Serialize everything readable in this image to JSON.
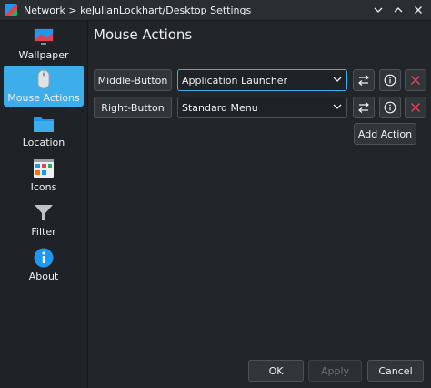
{
  "window": {
    "title": "Network > keJulianLockhart/Desktop Settings",
    "buttons": [
      "minimize",
      "maximize",
      "close"
    ]
  },
  "sidebar": {
    "items": [
      {
        "label": "Wallpaper",
        "icon": "wallpaper-icon",
        "active": false
      },
      {
        "label": "Mouse Actions",
        "icon": "mouse-icon",
        "active": true
      },
      {
        "label": "Location",
        "icon": "folder-icon",
        "active": false
      },
      {
        "label": "Icons",
        "icon": "icons-view-icon",
        "active": false
      },
      {
        "label": "Filter",
        "icon": "filter-icon",
        "active": false
      },
      {
        "label": "About",
        "icon": "info-icon",
        "active": false
      }
    ]
  },
  "main": {
    "heading": "Mouse Actions",
    "actions": [
      {
        "trigger": "Middle-Button",
        "plugin": "Application Launcher"
      },
      {
        "trigger": "Right-Button",
        "plugin": "Standard Menu"
      }
    ],
    "add_action_label": "Add Action"
  },
  "footer": {
    "ok_label": "OK",
    "apply_label": "Apply",
    "cancel_label": "Cancel"
  },
  "colors": {
    "accent": "#3daee9",
    "background": "#232629",
    "delete": "#da4453"
  }
}
